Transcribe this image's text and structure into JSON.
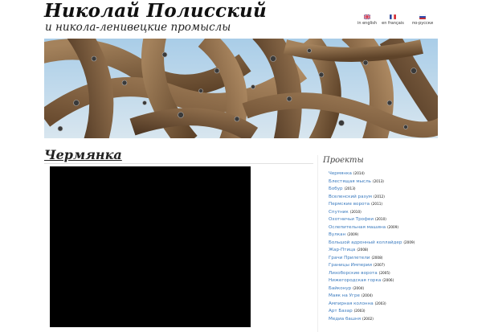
{
  "header": {
    "site_title": "Николай Полисский",
    "subtitle": "и никола-ленивецкие промыслы"
  },
  "languages": [
    {
      "label": "in english",
      "flag": "flag-uk-icon"
    },
    {
      "label": "en français",
      "flag": "flag-fr-icon"
    },
    {
      "label": "по-русски",
      "flag": "flag-ru-icon"
    }
  ],
  "page": {
    "title": "Чермянка"
  },
  "sidebar": {
    "title": "Проекты",
    "items": [
      {
        "name": "Чермянка",
        "year": "(2014)"
      },
      {
        "name": "Блестящая мысль",
        "year": "(2013)"
      },
      {
        "name": "Бобур",
        "year": "(2013)"
      },
      {
        "name": "Вселенский разум",
        "year": "(2012)"
      },
      {
        "name": "Пермские ворота",
        "year": "(2011)"
      },
      {
        "name": "Спутник",
        "year": "(2010)"
      },
      {
        "name": "Охотничьи Трофеи",
        "year": "(2010)"
      },
      {
        "name": "Ослепительная машина",
        "year": "(2009)"
      },
      {
        "name": "Вулкан",
        "year": "(2009)"
      },
      {
        "name": "Большой адронный коллайдер",
        "year": "(2009)"
      },
      {
        "name": "Жар-Птица",
        "year": "(2008)"
      },
      {
        "name": "Грачи Прилетели",
        "year": "(2008)"
      },
      {
        "name": "Границы Империи",
        "year": "(2007)"
      },
      {
        "name": "Лихоборские ворота",
        "year": "(2005)"
      },
      {
        "name": "Нижегородская горка",
        "year": "(2006)"
      },
      {
        "name": "Байконур",
        "year": "(2004)"
      },
      {
        "name": "Маяк на Угре",
        "year": "(2004)"
      },
      {
        "name": "Ампирная колонна",
        "year": "(2003)"
      },
      {
        "name": "Арт Базар",
        "year": "(2003)"
      },
      {
        "name": "Медиа башня",
        "year": "(2002)"
      }
    ]
  },
  "colors": {
    "link": "#3b7bbf",
    "video_bg": "#000000",
    "wood": "#8a6a48",
    "sky": "#9ec3e0"
  }
}
